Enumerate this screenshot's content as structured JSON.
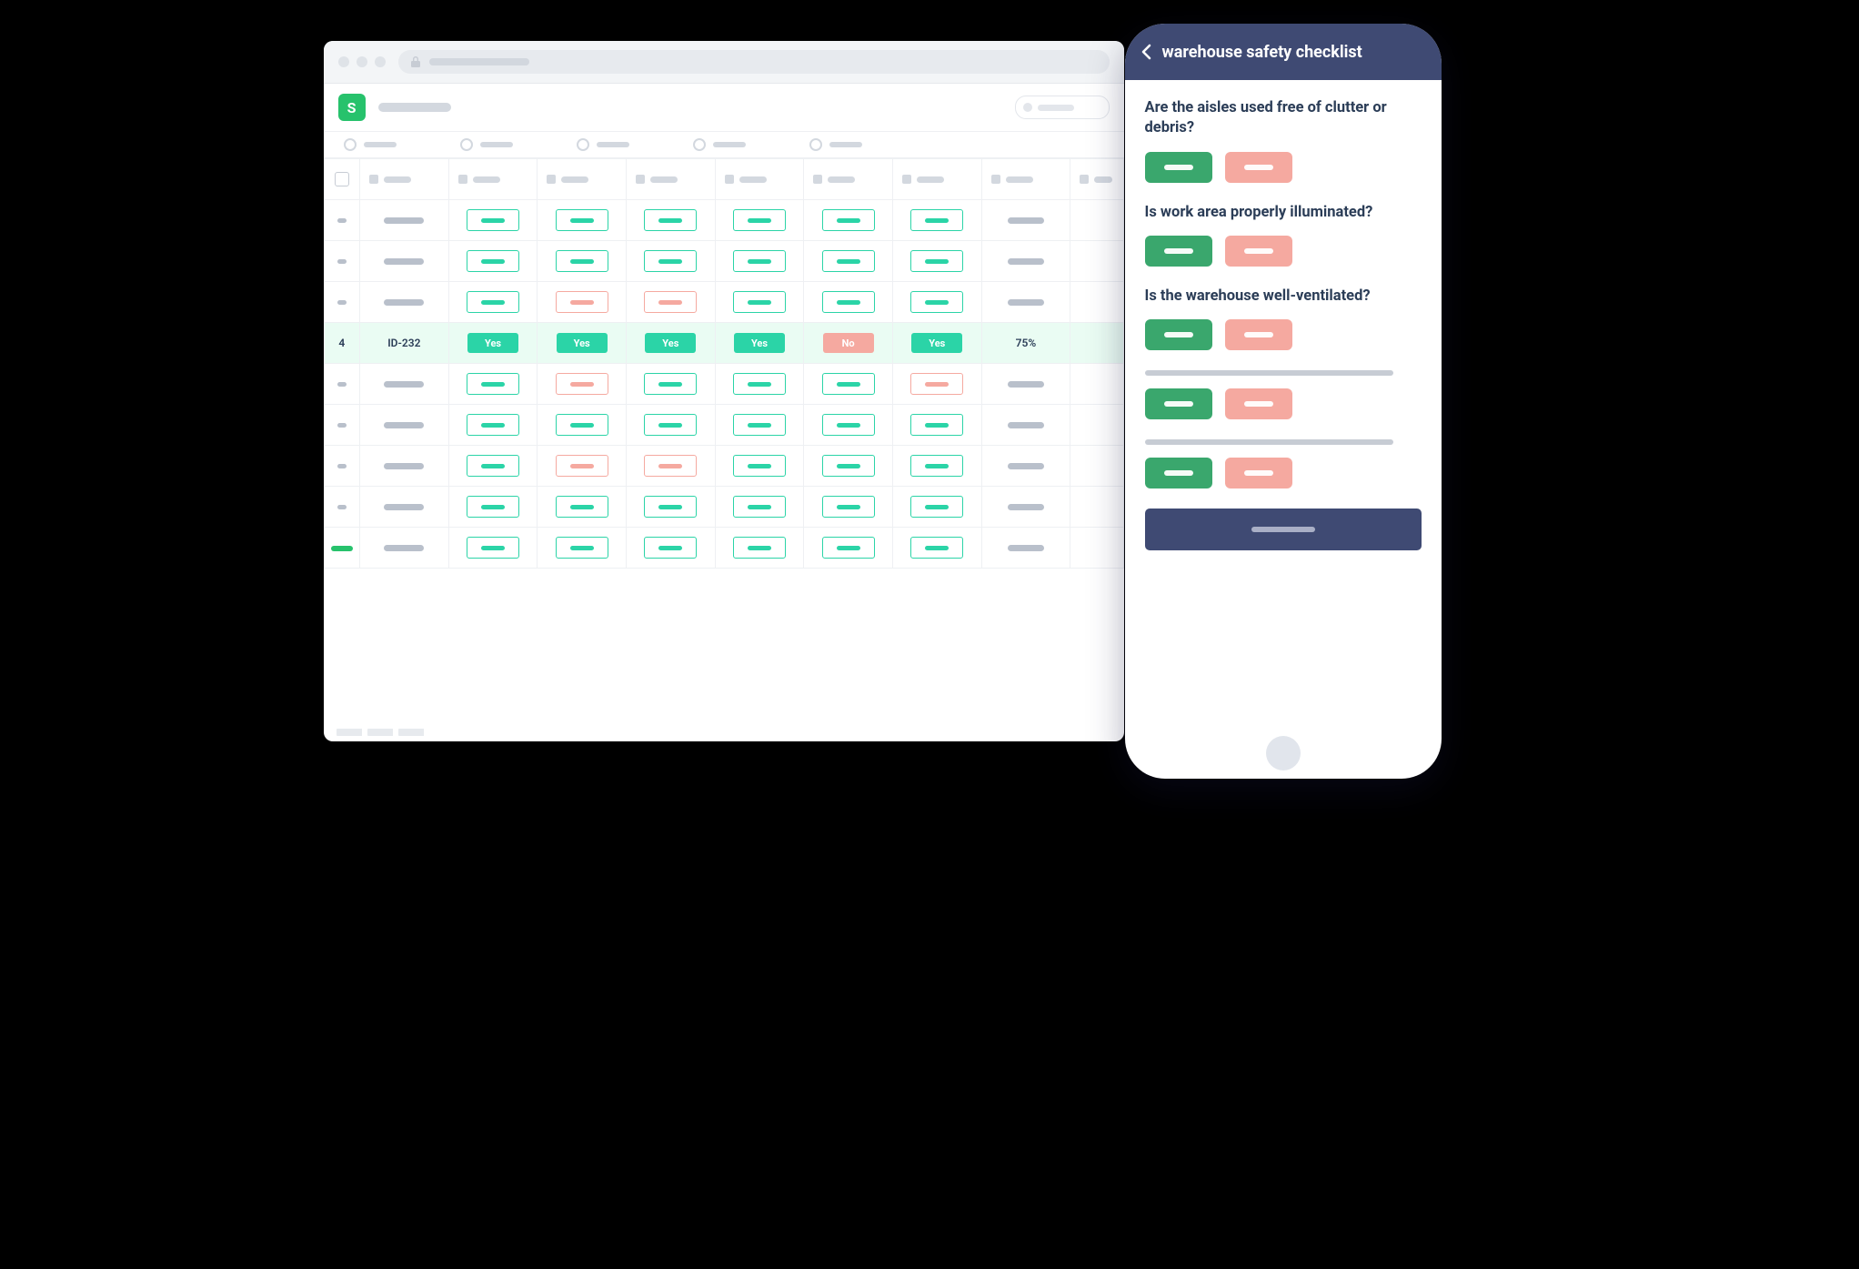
{
  "colors": {
    "accent_green": "#2bd4a7",
    "brand_green": "#27c26c",
    "accent_red": "#f5a9a0",
    "navy": "#3f4a73",
    "glow": "#453fff"
  },
  "browser": {
    "logo_letter": "S",
    "highlighted_row": {
      "index": "4",
      "id": "ID-232",
      "answers": [
        "Yes",
        "Yes",
        "Yes",
        "Yes",
        "No",
        "Yes"
      ],
      "percent": "75%"
    },
    "rows": [
      {
        "answers_style": [
          "yes",
          "yes",
          "yes",
          "yes",
          "yes",
          "yes"
        ]
      },
      {
        "answers_style": [
          "yes",
          "yes",
          "yes",
          "yes",
          "yes",
          "yes"
        ]
      },
      {
        "answers_style": [
          "yes",
          "no",
          "no",
          "yes",
          "yes",
          "yes"
        ]
      },
      {
        "highlight": true
      },
      {
        "answers_style": [
          "yes",
          "no",
          "yes",
          "yes",
          "yes",
          "no"
        ]
      },
      {
        "answers_style": [
          "yes",
          "yes",
          "yes",
          "yes",
          "yes",
          "yes"
        ]
      },
      {
        "answers_style": [
          "yes",
          "no",
          "no",
          "yes",
          "yes",
          "yes"
        ]
      },
      {
        "answers_style": [
          "yes",
          "yes",
          "yes",
          "yes",
          "yes",
          "yes"
        ]
      },
      {
        "footer": true,
        "answers_style": [
          "yes",
          "yes",
          "yes",
          "yes",
          "yes",
          "yes"
        ]
      }
    ]
  },
  "phone": {
    "title": "warehouse safety checklist",
    "questions": [
      "Are the aisles used free of clutter or debris?",
      "Is work area properly illuminated?",
      "Is the warehouse well-ventilated?"
    ],
    "placeholder_question_count": 2
  }
}
